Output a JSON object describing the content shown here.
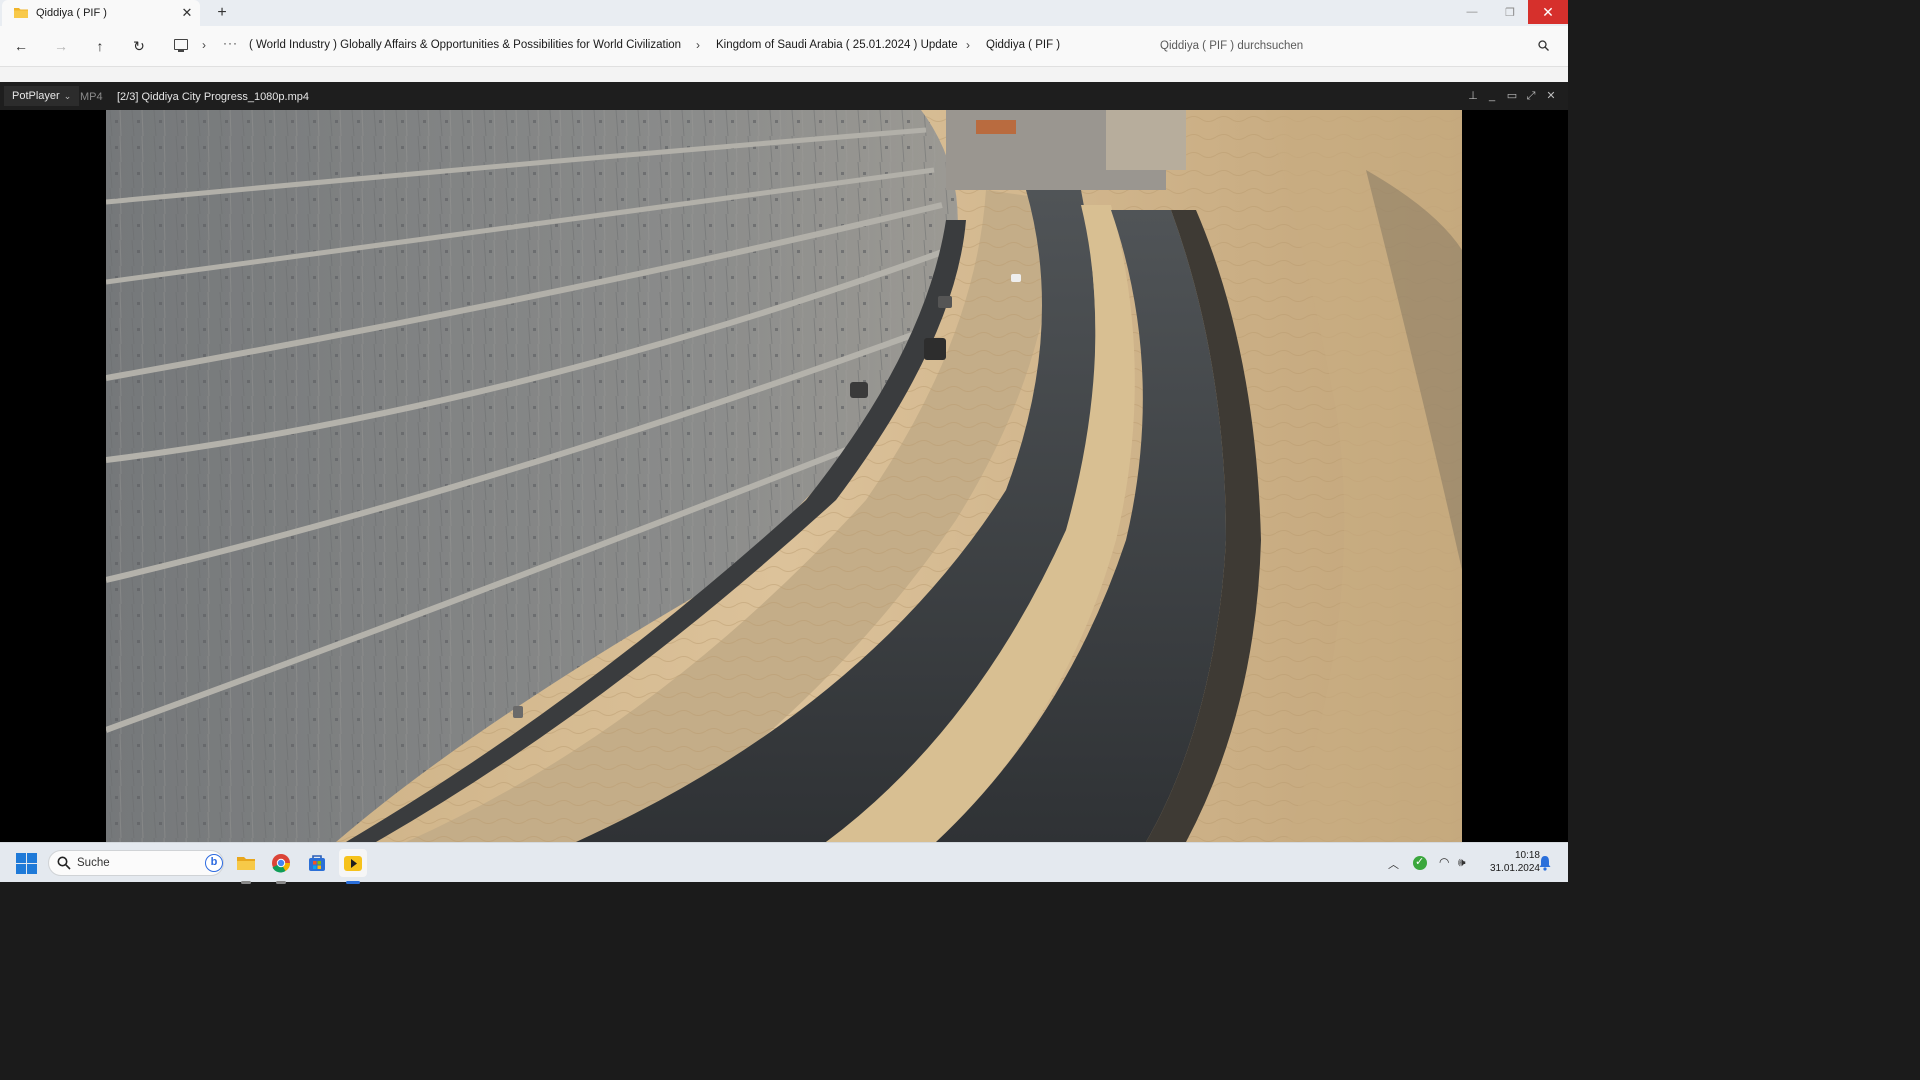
{
  "explorer": {
    "tab_title": "Qiddiya ( PIF )",
    "window_controls": {
      "minimize": "—",
      "restore": "❐",
      "close": "✕"
    },
    "breadcrumbs": [
      "( World Industry ) Globally Affairs & Opportunities & Possibilities for World Civilization",
      "Kingdom of Saudi Arabia ( 25.01.2024 ) Update",
      "Qiddiya ( PIF )"
    ],
    "breadcrumb_overflow": "···",
    "search_placeholder": "Qiddiya ( PIF ) durchsuchen"
  },
  "player": {
    "menu_label": "PotPlayer",
    "format_label": "MP4",
    "file_title": "[2/3] Qiddiya City Progress_1080p.mp4",
    "controls": [
      "pin-icon",
      "minimize-icon",
      "maximize-icon",
      "fullscreen-icon",
      "close-icon"
    ]
  },
  "taskbar": {
    "search_label": "Suche",
    "bing_label": "b",
    "apps": [
      {
        "name": "file-explorer",
        "active": false
      },
      {
        "name": "chrome",
        "active": false
      },
      {
        "name": "microsoft-store",
        "active": false
      },
      {
        "name": "potplayer",
        "active": true
      }
    ],
    "time": "10:18",
    "date": "31.01.2024"
  },
  "colors": {
    "accent": "#2a6fdb",
    "close_red": "#d6302c",
    "player_bar": "#1e1e1e"
  }
}
